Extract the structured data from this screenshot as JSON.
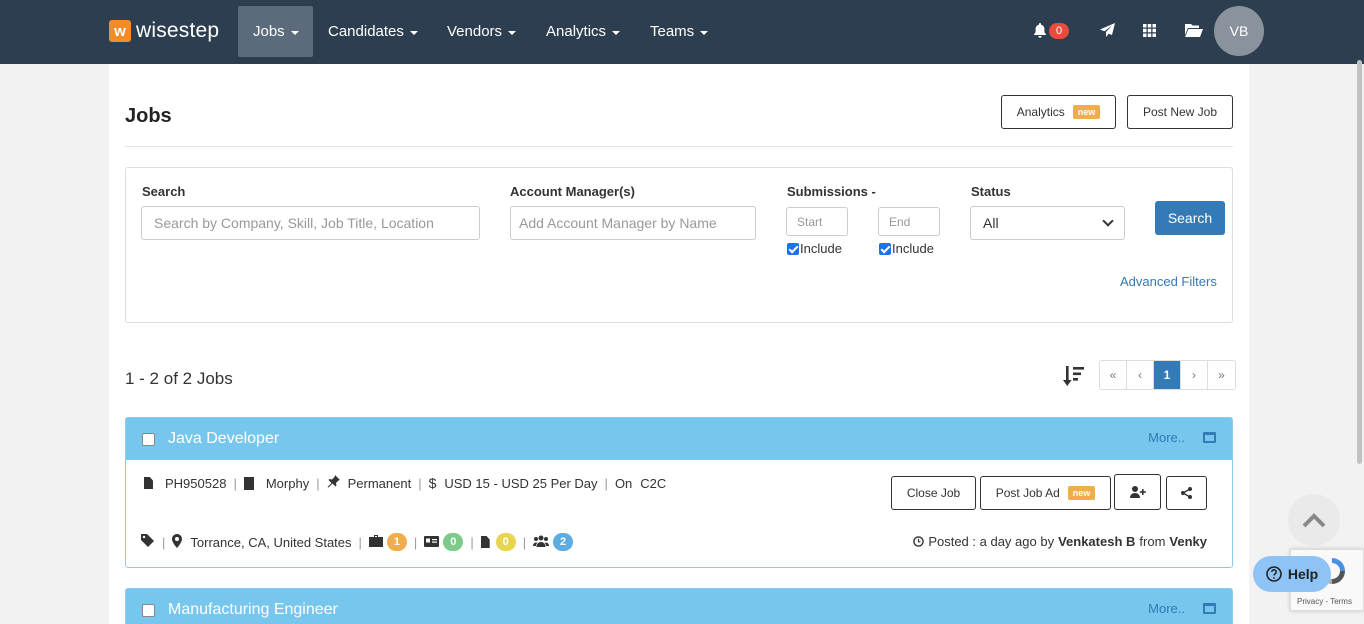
{
  "navbar": {
    "brand_letter": "w",
    "brand_name": "wisestep",
    "menu": [
      {
        "label": "Jobs"
      },
      {
        "label": "Candidates"
      },
      {
        "label": "Vendors"
      },
      {
        "label": "Analytics"
      },
      {
        "label": "Teams"
      }
    ],
    "icons": [
      "bell-icon",
      "paper-plane-icon",
      "grid-icon",
      "folder-icon"
    ],
    "notification_count": "0",
    "user_initials": "VB"
  },
  "page": {
    "title": "Jobs",
    "analytics_label": "Analytics",
    "new_badge": "new",
    "post_new_job_label": "Post New Job"
  },
  "filters": {
    "search_label": "Search",
    "search_placeholder": "Search by Company, Skill, Job Title, Location",
    "account_manager_label": "Account Manager(s)",
    "account_manager_placeholder": "Add Account Manager by Name",
    "submissions_label": "Submissions -",
    "start_placeholder": "Start",
    "end_placeholder": "End",
    "include_label": "Include",
    "status_label": "Status",
    "status_value": "All",
    "search_button": "Search",
    "advanced_filters": "Advanced Filters"
  },
  "results": {
    "count_text": "1 - 2 of 2 Jobs",
    "pagination": [
      "«",
      "‹",
      "1",
      "›",
      "»"
    ],
    "current_page": "1"
  },
  "jobs": [
    {
      "title": "Java Developer",
      "more": "More..",
      "job_id": "PH950528",
      "company": "Morphy",
      "job_type": "Permanent",
      "rate": "USD 15 - USD 25 Per Day",
      "on_label": "On",
      "engagement": "C2C",
      "location": "Torrance, CA, United States",
      "counts": {
        "submissions": "1",
        "interviews": "0",
        "documents": "0",
        "team": "2"
      },
      "close_job": "Close Job",
      "post_job_ad": "Post Job Ad",
      "new_badge": "new",
      "posted_prefix": "Posted : a day ago by",
      "posted_by": "Venkatesh B",
      "from_label": "from",
      "from_name": "Venky"
    },
    {
      "title": "Manufacturing Engineer",
      "more": "More.."
    }
  ],
  "help_label": "Help",
  "recaptcha_text": "Privacy - Terms",
  "colors": {
    "navbar": "#2c3e50",
    "primary": "#337ab7",
    "card_header": "#76c6ee",
    "badge_orange": "#f0ad4e",
    "badge_green": "#7fc98b",
    "badge_yellow": "#e8d44d",
    "badge_blue": "#5dade2",
    "notification": "#e74c3c"
  }
}
